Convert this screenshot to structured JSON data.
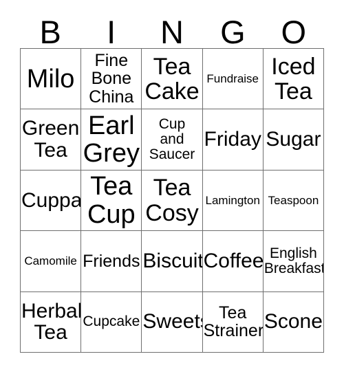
{
  "card": {
    "header_letters": [
      "B",
      "I",
      "N",
      "G",
      "O"
    ],
    "border_color": "#6e6e6e",
    "text_color": "#000000",
    "background_color": "#ffffff",
    "rows": [
      [
        {
          "text": "Milo",
          "size": "sz-xl"
        },
        {
          "text": "Fine\nBone\nChina",
          "size": "sz-sm"
        },
        {
          "text": "Tea\nCake",
          "size": "sz-lg"
        },
        {
          "text": "Fundraise",
          "size": "sz-xxs"
        },
        {
          "text": "Iced\nTea",
          "size": "sz-lg"
        }
      ],
      [
        {
          "text": "Green\nTea",
          "size": "sz-md"
        },
        {
          "text": "Earl\nGrey",
          "size": "sz-xl"
        },
        {
          "text": "Cup\nand\nSaucer",
          "size": "sz-xs"
        },
        {
          "text": "Friday",
          "size": "sz-md"
        },
        {
          "text": "Sugar",
          "size": "sz-md"
        }
      ],
      [
        {
          "text": "Cuppa",
          "size": "sz-md"
        },
        {
          "text": "Tea\nCup",
          "size": "sz-xl"
        },
        {
          "text": "Tea\nCosy",
          "size": "sz-lg"
        },
        {
          "text": "Lamington",
          "size": "sz-xxs"
        },
        {
          "text": "Teaspoon",
          "size": "sz-xxs"
        }
      ],
      [
        {
          "text": "Camomile",
          "size": "sz-xxs"
        },
        {
          "text": "Friends",
          "size": "sz-sm"
        },
        {
          "text": "Biscuit",
          "size": "sz-md"
        },
        {
          "text": "Coffee",
          "size": "sz-md"
        },
        {
          "text": "English\nBreakfast",
          "size": "sz-xs"
        }
      ],
      [
        {
          "text": "Herbal\nTea",
          "size": "sz-md"
        },
        {
          "text": "Cupcake",
          "size": "sz-xs"
        },
        {
          "text": "Sweets",
          "size": "sz-md"
        },
        {
          "text": "Tea\nStrainer",
          "size": "sz-sm"
        },
        {
          "text": "Scones",
          "size": "sz-md"
        }
      ]
    ]
  }
}
